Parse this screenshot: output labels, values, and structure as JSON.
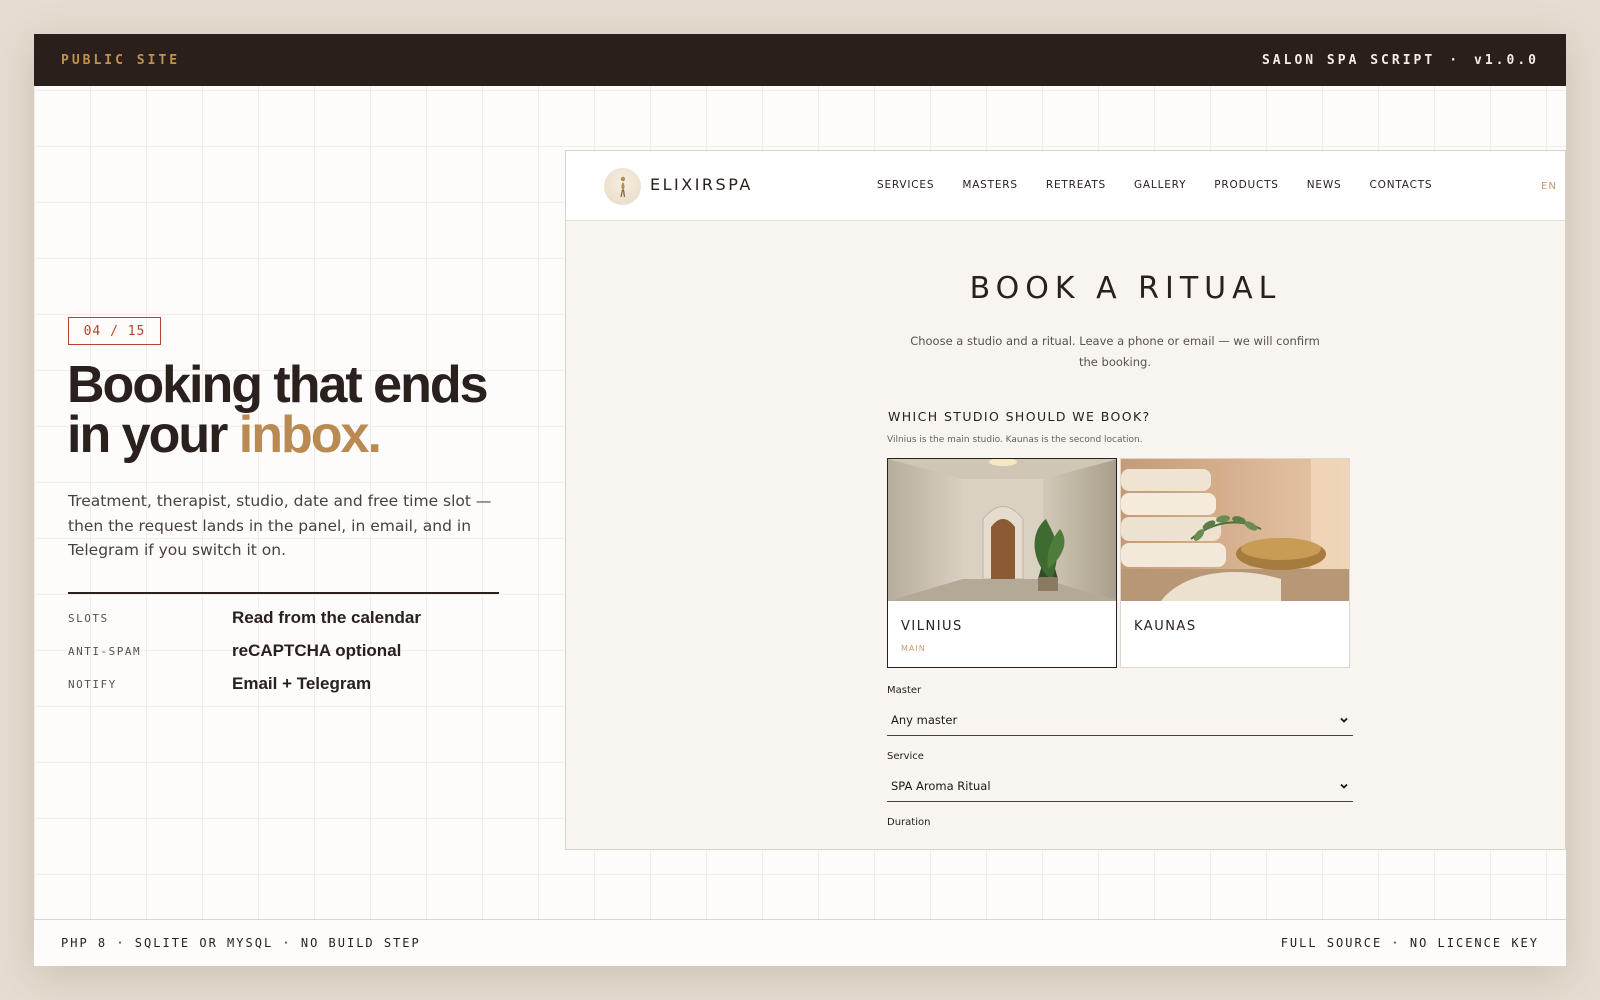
{
  "topbar": {
    "left_label": "PUBLIC SITE",
    "product": "SALON SPA SCRIPT",
    "separator": "·",
    "version": "v1.0.0",
    "accent_color": "#c4914d"
  },
  "hero": {
    "counter": "04 / 15",
    "headline_line1": "Booking that ends",
    "headline_line2_plain": "in your",
    "headline_line2_accent": "inbox.",
    "lede": "Treatment, therapist, studio, date and free time slot — then the request lands in the panel, in email, and in Telegram if you switch it on.",
    "specs": [
      {
        "key": "SLOTS",
        "value": "Read from the calendar"
      },
      {
        "key": "ANTI-SPAM",
        "value": "reCAPTCHA optional"
      },
      {
        "key": "NOTIFY",
        "value": "Email + Telegram"
      }
    ]
  },
  "site": {
    "logo": "ELIXIRSPA",
    "nav": [
      "SERVICES",
      "MASTERS",
      "RETREATS",
      "GALLERY",
      "PRODUCTS",
      "NEWS",
      "CONTACTS"
    ],
    "lang": "EN",
    "title": "BOOK A RITUAL",
    "subtitle": "Choose a studio and a ritual. Leave a phone or email — we will confirm the booking.",
    "studio_question": "WHICH STUDIO SHOULD WE BOOK?",
    "studio_hint": "Vilnius is the main studio. Kaunas is the second location.",
    "studios": [
      {
        "name": "VILNIUS",
        "tag": "MAIN",
        "selected": true
      },
      {
        "name": "KAUNAS",
        "tag": "",
        "selected": false
      }
    ],
    "fields": {
      "master_label": "Master",
      "master_value": "Any master",
      "service_label": "Service",
      "service_value": "SPA Aroma Ritual",
      "duration_label": "Duration"
    }
  },
  "bottombar": {
    "left": "PHP 8 · SQLITE OR MYSQL · NO BUILD STEP",
    "right": "FULL SOURCE · NO LICENCE KEY"
  }
}
